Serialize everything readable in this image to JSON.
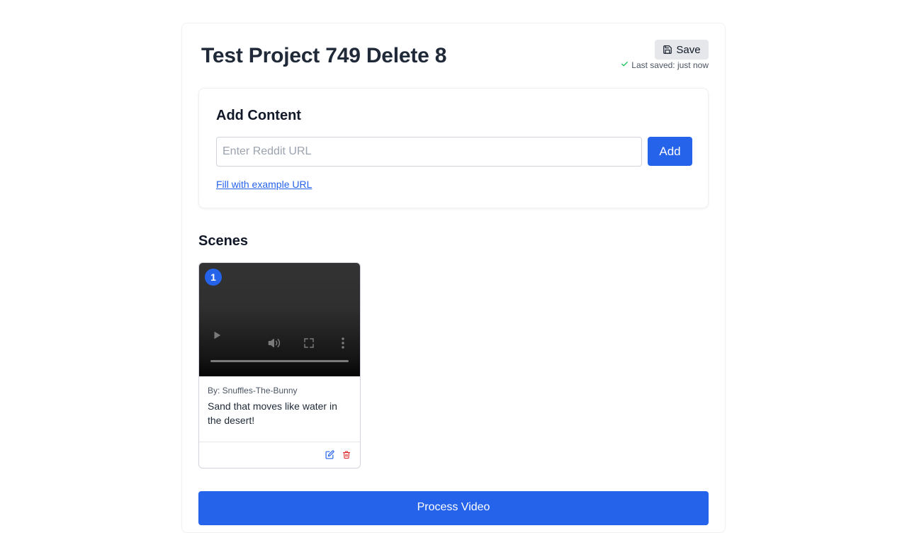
{
  "project": {
    "title": "Test Project 749 Delete 8"
  },
  "header": {
    "save_label": "Save",
    "save_icon": "floppy-disk-icon",
    "last_saved": "Last saved: just now",
    "status_icon": "check-icon"
  },
  "add_content": {
    "title": "Add Content",
    "url_placeholder": "Enter Reddit URL",
    "url_value": "",
    "add_label": "Add",
    "example_link": "Fill with example URL"
  },
  "scenes": {
    "title": "Scenes",
    "items": [
      {
        "number": "1",
        "author": "By: Snuffles-The-Bunny",
        "caption": "Sand that moves like water in the desert!"
      }
    ]
  },
  "process_label": "Process Video",
  "colors": {
    "accent": "#2563eb",
    "danger": "#dc2626",
    "success": "#22c55e"
  }
}
